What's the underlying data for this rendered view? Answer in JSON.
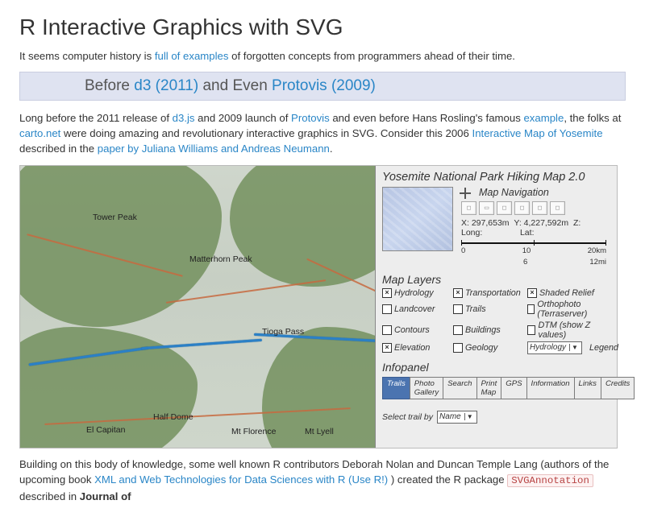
{
  "title": "R Interactive Graphics with SVG",
  "intro": {
    "pre": "It seems computer history is ",
    "link": "full of examples",
    "post": " of forgotten concepts from programmers ahead of their time."
  },
  "subhead": {
    "before": "Before ",
    "d3": "d3 (2011)",
    "mid": " and Even ",
    "protovis": "Protovis (2009)"
  },
  "para1": {
    "a": "Long before the 2011 release of ",
    "d3": "d3.js",
    "b": " and 2009 launch of ",
    "proto": "Protovis",
    "c": " and even before Hans Rosling's famous ",
    "example": "example",
    "d": ", the folks at ",
    "carto": "carto.net",
    "e": " were doing amazing and revolutionary interactive graphics in SVG. Consider this 2006 ",
    "yosemite": "Interactive Map of Yosemite",
    "f": " described in the ",
    "paper": "paper by Juliana Williams and Andreas Neumann",
    "g": "."
  },
  "map": {
    "labels": {
      "towerPeak": "Tower Peak",
      "matterhorn": "Matterhorn Peak",
      "tioga": "Tioga Pass",
      "halfDome": "Half Dome",
      "elCapitan": "El Capitan",
      "mtFlorence": "Mt Florence",
      "mtLyell": "Mt Lyell"
    },
    "panel": {
      "title": "Yosemite National Park Hiking Map 2.0",
      "navTitle": "Map Navigation",
      "coordsX": "X: 297,653m",
      "coordsY": "Y: 4,227,592m",
      "coordsZ": "Z:",
      "long": "Long:",
      "lat": "Lat:",
      "scale": {
        "a": "0",
        "b": "10",
        "c": "20km",
        "d": "6",
        "e": "12mi"
      },
      "layersTitle": "Map Layers",
      "layers": [
        {
          "label": "Hydrology",
          "checked": true
        },
        {
          "label": "Transportation",
          "checked": true
        },
        {
          "label": "Shaded Relief",
          "checked": true
        },
        {
          "label": "Landcover",
          "checked": false
        },
        {
          "label": "Trails",
          "checked": false
        },
        {
          "label": "Orthophoto (Terraserver)",
          "checked": false
        },
        {
          "label": "Contours",
          "checked": false
        },
        {
          "label": "Buildings",
          "checked": false
        },
        {
          "label": "DTM (show Z values)",
          "checked": false
        },
        {
          "label": "Elevation",
          "checked": true
        },
        {
          "label": "Geology",
          "checked": false
        }
      ],
      "legendSel": "Hydrology",
      "legendLabel": "Legend",
      "infoTitle": "Infopanel",
      "tabs": [
        "Trails",
        "Photo Gallery",
        "Search",
        "Print Map",
        "GPS",
        "Information",
        "Links",
        "Credits"
      ],
      "activeTabIndex": 0,
      "selectTrail": "Select trail by",
      "selectTrailOpt": "Name"
    }
  },
  "para2": {
    "a": "Building on this body of knowledge, some well known R contributors Deborah Nolan and Duncan Temple Lang (authors of the upcoming book ",
    "bookLink": "XML and Web Technologies for Data Sciences with R (Use R!)",
    "b": " ) created the R package ",
    "code": "SVGAnnotation",
    "c": " described in ",
    "journal": "Journal of"
  }
}
